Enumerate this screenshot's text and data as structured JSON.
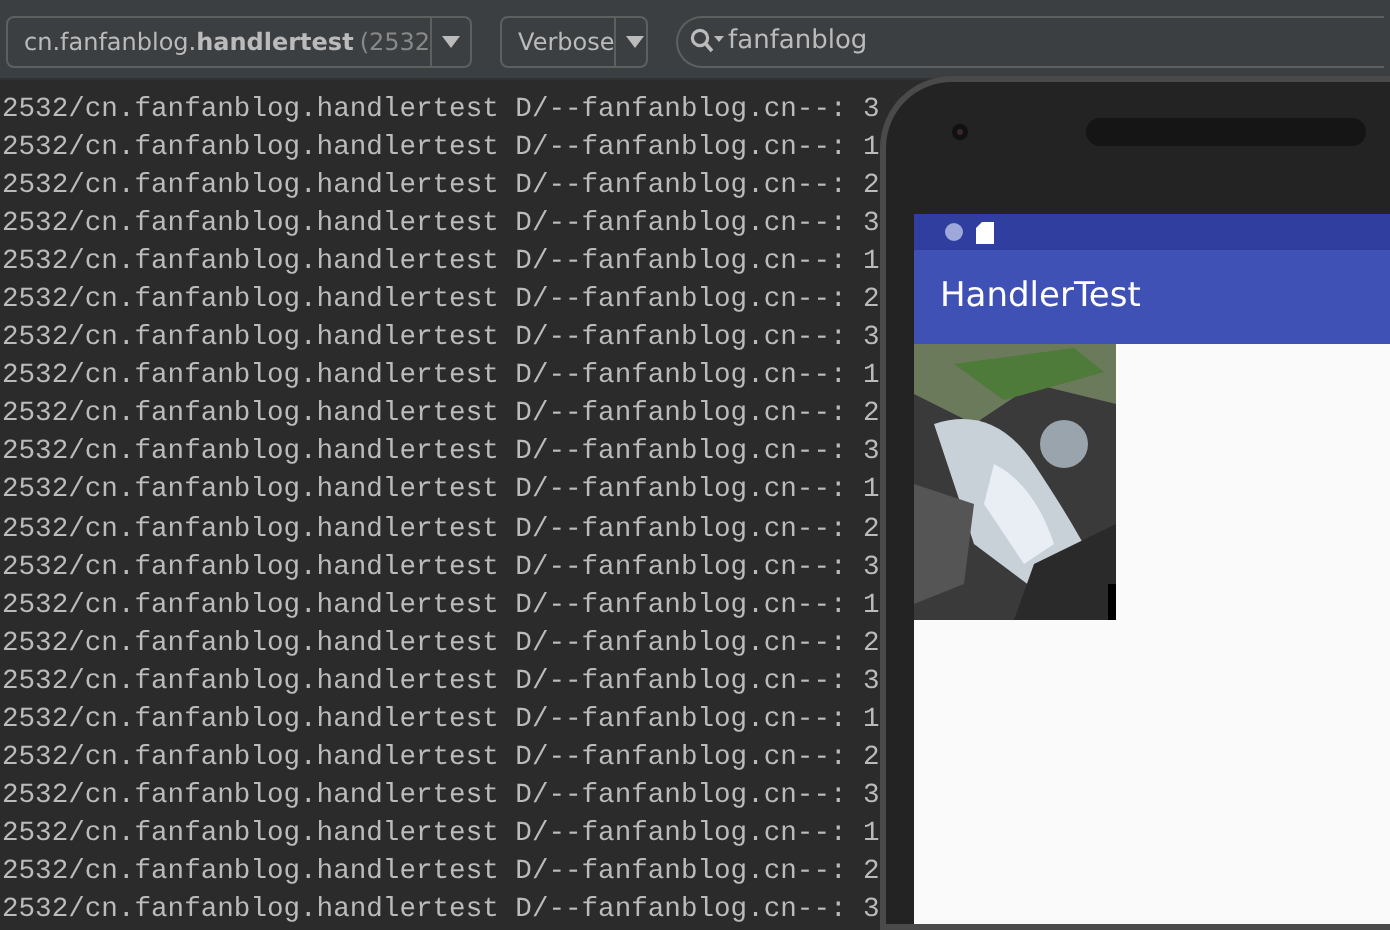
{
  "toolbar": {
    "process_selector": {
      "text": "cn.fanfanblog.**handlertest**",
      "pid": "(2532"
    },
    "level_selector": "Verbose",
    "search": {
      "value": "fanfanblog"
    }
  },
  "log_lines": [
    "2532/cn.fanfanblog.handlertest D/--fanfanblog.cn--: 3",
    "2532/cn.fanfanblog.handlertest D/--fanfanblog.cn--: 1",
    "2532/cn.fanfanblog.handlertest D/--fanfanblog.cn--: 2",
    "2532/cn.fanfanblog.handlertest D/--fanfanblog.cn--: 3",
    "2532/cn.fanfanblog.handlertest D/--fanfanblog.cn--: 1",
    "2532/cn.fanfanblog.handlertest D/--fanfanblog.cn--: 2",
    "2532/cn.fanfanblog.handlertest D/--fanfanblog.cn--: 3",
    "2532/cn.fanfanblog.handlertest D/--fanfanblog.cn--: 1",
    "2532/cn.fanfanblog.handlertest D/--fanfanblog.cn--: 2",
    "2532/cn.fanfanblog.handlertest D/--fanfanblog.cn--: 3",
    "2532/cn.fanfanblog.handlertest D/--fanfanblog.cn--: 1",
    "2532/cn.fanfanblog.handlertest D/--fanfanblog.cn--: 2",
    "2532/cn.fanfanblog.handlertest D/--fanfanblog.cn--: 3",
    "2532/cn.fanfanblog.handlertest D/--fanfanblog.cn--: 1",
    "2532/cn.fanfanblog.handlertest D/--fanfanblog.cn--: 2",
    "2532/cn.fanfanblog.handlertest D/--fanfanblog.cn--: 3",
    "2532/cn.fanfanblog.handlertest D/--fanfanblog.cn--: 1",
    "2532/cn.fanfanblog.handlertest D/--fanfanblog.cn--: 2",
    "2532/cn.fanfanblog.handlertest D/--fanfanblog.cn--: 3",
    "2532/cn.fanfanblog.handlertest D/--fanfanblog.cn--: 1",
    "2532/cn.fanfanblog.handlertest D/--fanfanblog.cn--: 2",
    "2532/cn.fanfanblog.handlertest D/--fanfanblog.cn--: 3"
  ],
  "emulator": {
    "app_title": "HandlerTest"
  }
}
